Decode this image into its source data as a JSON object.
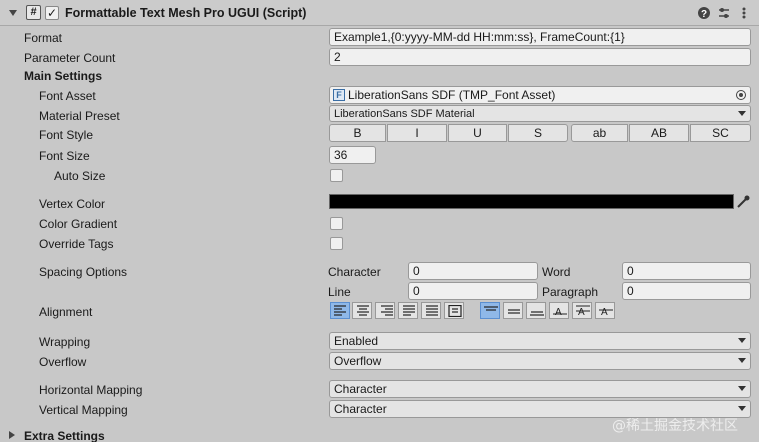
{
  "header": {
    "title": "Formattable Text Mesh Pro UGUI (Script)",
    "component_icon": "#",
    "enabled": true
  },
  "format": {
    "label": "Format",
    "value": "Example1,{0:yyyy-MM-dd HH:mm:ss}, FrameCount:{1}"
  },
  "parameter_count": {
    "label": "Parameter Count",
    "value": "2"
  },
  "main_settings": {
    "heading": "Main Settings",
    "font_asset": {
      "label": "Font Asset",
      "value": "LiberationSans SDF (TMP_Font Asset)"
    },
    "material_preset": {
      "label": "Material Preset",
      "value": "LiberationSans SDF Material"
    },
    "font_style": {
      "label": "Font Style",
      "buttons": [
        "B",
        "I",
        "U",
        "S",
        "ab",
        "AB",
        "SC"
      ]
    },
    "font_size": {
      "label": "Font Size",
      "value": "36"
    },
    "auto_size": {
      "label": "Auto Size"
    },
    "vertex_color": {
      "label": "Vertex Color",
      "color": "#000000"
    },
    "color_gradient": {
      "label": "Color Gradient"
    },
    "override_tags": {
      "label": "Override Tags"
    },
    "spacing": {
      "label": "Spacing Options",
      "character_label": "Character",
      "character_value": "0",
      "word_label": "Word",
      "word_value": "0",
      "line_label": "Line",
      "line_value": "0",
      "paragraph_label": "Paragraph",
      "paragraph_value": "0"
    },
    "alignment": {
      "label": "Alignment"
    },
    "wrapping": {
      "label": "Wrapping",
      "value": "Enabled"
    },
    "overflow": {
      "label": "Overflow",
      "value": "Overflow"
    },
    "horizontal_mapping": {
      "label": "Horizontal Mapping",
      "value": "Character"
    },
    "vertical_mapping": {
      "label": "Vertical Mapping",
      "value": "Character"
    }
  },
  "extra_settings": {
    "heading": "Extra Settings"
  },
  "watermark": "@稀土掘金技术社区",
  "colors": {
    "accent": "#8fb8e8",
    "panel": "#c8c8c8"
  }
}
